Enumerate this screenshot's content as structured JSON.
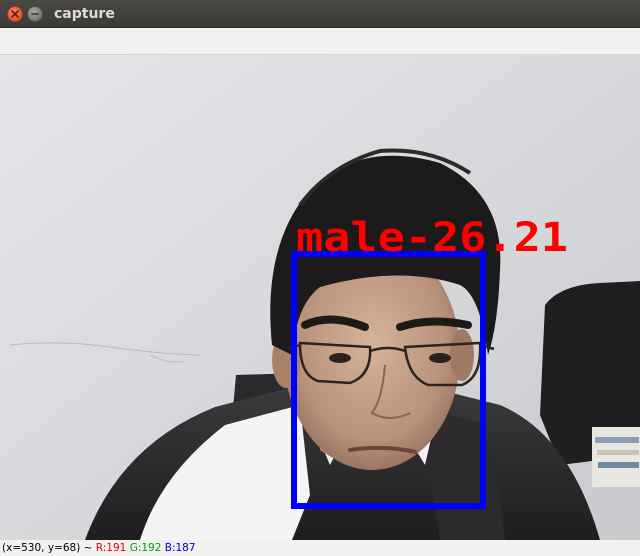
{
  "window": {
    "title": "capture"
  },
  "detection": {
    "label": "male-26.21",
    "label_color": "#ff0000",
    "box_color": "#0000ff"
  },
  "status": {
    "coords": "(x=530, y=68) ~",
    "r": "R:191",
    "g": "G:192",
    "b": "B:187"
  },
  "colors": {
    "wall": "#d9dadc",
    "shirt": "#2a2a2c",
    "hair": "#1c1a1a",
    "skin": "#c7a28a"
  }
}
